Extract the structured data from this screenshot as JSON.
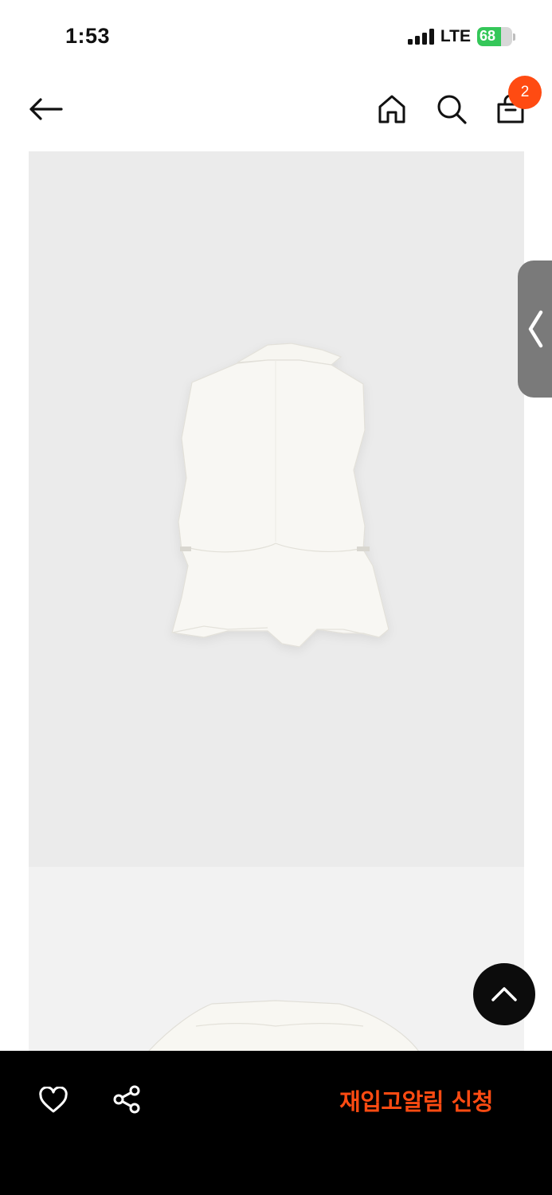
{
  "status_bar": {
    "time": "1:53",
    "network": "LTE",
    "battery_level": "68",
    "battery_fraction": 0.68,
    "signal_bars": 4
  },
  "header": {
    "cart_count": "2",
    "icons": {
      "back": "arrow-left-icon",
      "home": "home-icon",
      "search": "search-icon",
      "cart": "shopping-bag-icon"
    }
  },
  "product": {
    "images": [
      {
        "subject": "white-sleeveless-vest",
        "view": "back"
      },
      {
        "subject": "white-sleeveless-vest",
        "view": "collar-detail"
      }
    ]
  },
  "bottom_bar": {
    "restock_label": "재입고알림 신청",
    "icons": {
      "wishlist": "heart-icon",
      "share": "share-icon"
    }
  },
  "colors": {
    "accent": "#ff4b12",
    "bottom_bar_bg": "#000000",
    "image_bg": "#ebebeb",
    "side_tab_bg": "#7a7a7a",
    "battery_fill": "#34c759"
  }
}
